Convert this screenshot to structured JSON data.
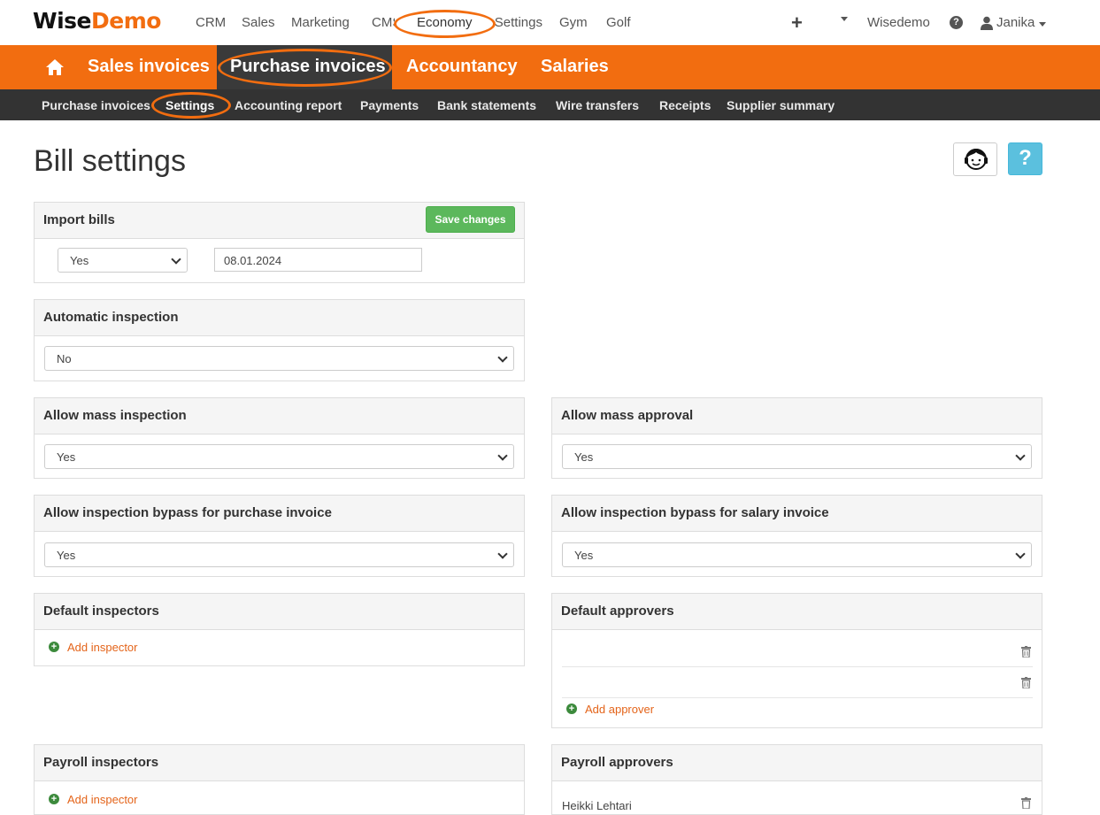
{
  "brand": {
    "part1": "Wise",
    "part2": "Demo"
  },
  "top_nav": {
    "items": [
      "CRM",
      "Sales",
      "Marketing",
      "CMS",
      "Economy",
      "Settings",
      "Gym",
      "Golf"
    ],
    "company": "Wisedemo",
    "user": "Janika"
  },
  "main_nav": {
    "items": [
      "Sales invoices",
      "Purchase invoices",
      "Accountancy",
      "Salaries"
    ]
  },
  "sub_nav": {
    "items": [
      "Purchase invoices",
      "Settings",
      "Accounting report",
      "Payments",
      "Bank statements",
      "Wire transfers",
      "Receipts",
      "Supplier summary"
    ]
  },
  "page": {
    "title": "Bill settings",
    "help_label": "?"
  },
  "import_bills": {
    "title": "Import bills",
    "save_label": "Save changes",
    "enabled_value": "Yes",
    "date_value": "08.01.2024"
  },
  "automatic_inspection": {
    "title": "Automatic inspection",
    "value": "No"
  },
  "allow_mass_inspection": {
    "title": "Allow mass inspection",
    "value": "Yes"
  },
  "allow_mass_approval": {
    "title": "Allow mass approval",
    "value": "Yes"
  },
  "bypass_purchase": {
    "title": "Allow inspection bypass for purchase invoice",
    "value": "Yes"
  },
  "bypass_salary": {
    "title": "Allow inspection bypass for salary invoice",
    "value": "Yes"
  },
  "default_inspectors": {
    "title": "Default inspectors",
    "add_label": "Add inspector"
  },
  "default_approvers": {
    "title": "Default approvers",
    "add_label": "Add approver"
  },
  "payroll_inspectors": {
    "title": "Payroll inspectors",
    "add_label": "Add inspector"
  },
  "payroll_approvers": {
    "title": "Payroll approvers",
    "first_row": "Heikki Lehtari"
  },
  "colors": {
    "accent": "#f26d10",
    "dark": "#333333",
    "success": "#5cb85c",
    "info": "#5bc0de",
    "link": "#e4641a"
  }
}
